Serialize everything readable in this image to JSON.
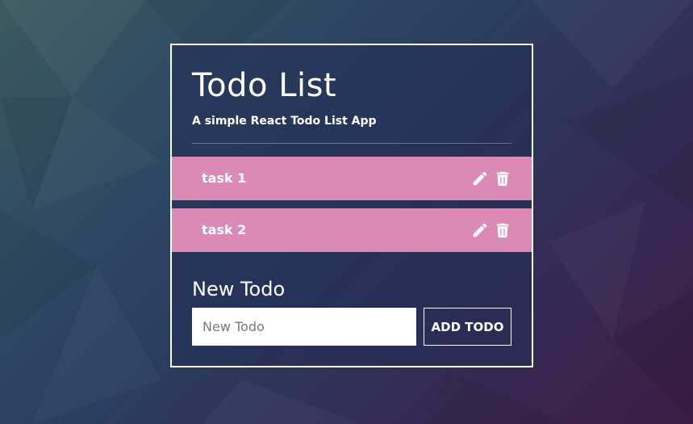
{
  "app": {
    "title": "Todo List",
    "subtitle": "A simple React Todo List App"
  },
  "todos": [
    {
      "text": "task 1",
      "edit_icon": "pencil-icon",
      "delete_icon": "trash-icon"
    },
    {
      "text": "task 2",
      "edit_icon": "pencil-icon",
      "delete_icon": "trash-icon"
    }
  ],
  "new_todo": {
    "heading": "New Todo",
    "input_value": "",
    "input_placeholder": "New Todo",
    "button_label": "ADD TODO"
  },
  "colors": {
    "todo_item_bg": "#db8ab5",
    "card_border": "#ffffff",
    "text": "#ffffff"
  }
}
